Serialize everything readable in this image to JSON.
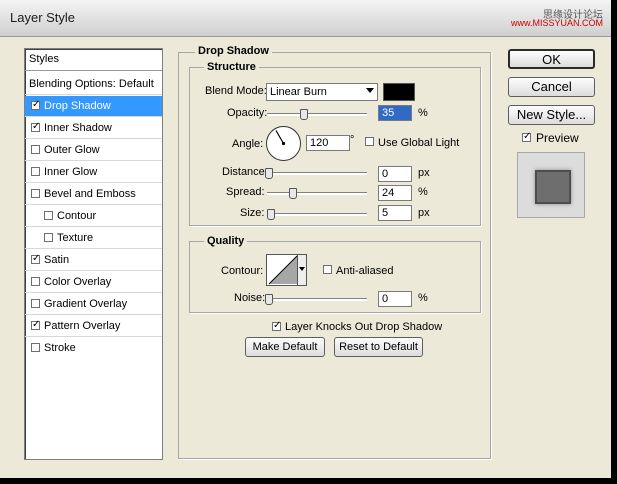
{
  "window": {
    "title": "Layer Style",
    "watermark_cn": "思缘设计论坛",
    "watermark_url": "www.MISSYUAN.COM"
  },
  "styles_list": {
    "header": "Styles",
    "items": [
      {
        "label": "Blending Options: Default",
        "checked": null
      },
      {
        "label": "Drop Shadow",
        "checked": true,
        "selected": true
      },
      {
        "label": "Inner Shadow",
        "checked": true
      },
      {
        "label": "Outer Glow",
        "checked": false
      },
      {
        "label": "Inner Glow",
        "checked": false
      },
      {
        "label": "Bevel and Emboss",
        "checked": false
      },
      {
        "label": "Contour",
        "checked": false,
        "sub": true
      },
      {
        "label": "Texture",
        "checked": false,
        "sub": true
      },
      {
        "label": "Satin",
        "checked": true
      },
      {
        "label": "Color Overlay",
        "checked": false
      },
      {
        "label": "Gradient Overlay",
        "checked": false
      },
      {
        "label": "Pattern Overlay",
        "checked": true
      },
      {
        "label": "Stroke",
        "checked": false
      }
    ]
  },
  "drop_shadow": {
    "title": "Drop Shadow",
    "structure": {
      "title": "Structure",
      "blend_mode_label": "Blend Mode:",
      "blend_mode_value": "Linear Burn",
      "color": "#000000",
      "opacity_label": "Opacity:",
      "opacity_value": "35",
      "opacity_unit": "%",
      "opacity_slider_fraction": 0.35,
      "angle_label": "Angle:",
      "angle_value": "120",
      "angle_unit": "°",
      "use_global_light_label": "Use Global Light",
      "use_global_light": false,
      "distance_label": "Distance:",
      "distance_value": "0",
      "distance_unit": "px",
      "distance_slider_fraction": 0.0,
      "spread_label": "Spread:",
      "spread_value": "24",
      "spread_unit": "%",
      "spread_slider_fraction": 0.24,
      "size_label": "Size:",
      "size_value": "5",
      "size_unit": "px",
      "size_slider_fraction": 0.02
    },
    "quality": {
      "title": "Quality",
      "contour_label": "Contour:",
      "anti_aliased_label": "Anti-aliased",
      "anti_aliased": false,
      "noise_label": "Noise:",
      "noise_value": "0",
      "noise_unit": "%",
      "noise_slider_fraction": 0.0
    },
    "knocks_out_label": "Layer Knocks Out Drop Shadow",
    "knocks_out": true,
    "make_default_label": "Make Default",
    "reset_default_label": "Reset to Default"
  },
  "buttons": {
    "ok": "OK",
    "cancel": "Cancel",
    "new_style": "New Style...",
    "preview_label": "Preview",
    "preview_checked": true
  }
}
